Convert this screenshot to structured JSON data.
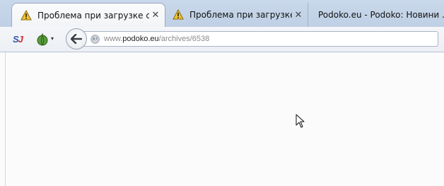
{
  "tabs": [
    {
      "title": "Проблема при загрузке с...",
      "icon": "warning-icon",
      "active": true,
      "close": "✕"
    },
    {
      "title": "Проблема при загрузке с...",
      "icon": "warning-icon",
      "active": false,
      "close": "✕"
    },
    {
      "title": "Podoko.eu - Podoko: Новини ...",
      "icon": "",
      "active": false
    }
  ],
  "toolbar": {
    "addon1_s": "S",
    "addon1_j": "J",
    "addon2_caret": "▾",
    "back_icon": "back-arrow-icon"
  },
  "address": {
    "prefix": "www.",
    "domain": "podoko.eu",
    "path": "/archives/6538"
  },
  "colors": {
    "tabstrip": "#c4d4e8",
    "warning": "#f1c232",
    "sj_blue": "#2a5aa8",
    "sj_red": "#d62a2a"
  }
}
